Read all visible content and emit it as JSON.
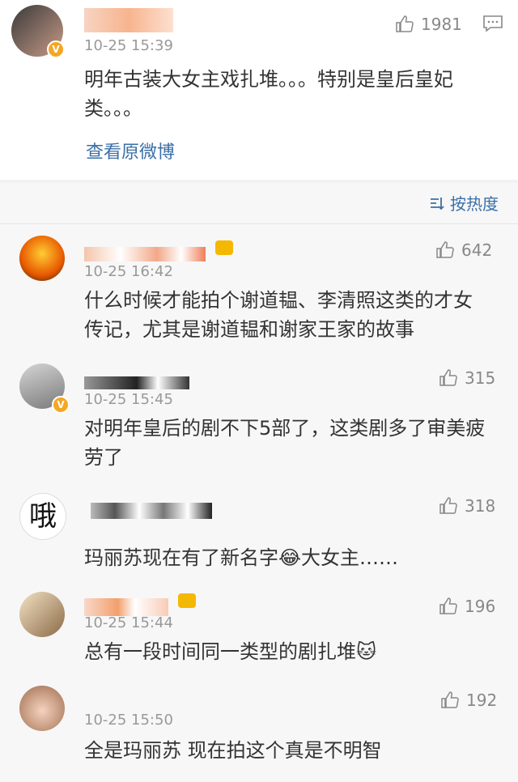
{
  "post": {
    "time": "10-25 15:39",
    "text": "明年古装大女主戏扎堆。。。特别是皇后皇妃类。。。",
    "likes": "1981",
    "view_original": "查看原微博"
  },
  "sort_label": "按热度",
  "comments": [
    {
      "time": "10-25 16:42",
      "text": "什么时候才能拍个谢道韫、李清照这类的才女传记，尤其是谢道韫和谢家王家的故事",
      "likes": "642"
    },
    {
      "time": "10-25 15:45",
      "text": "对明年皇后的剧不下5部了，这类剧多了审美疲劳了",
      "likes": "315"
    },
    {
      "time": "",
      "text": "玛丽苏现在有了新名字😂大女主……",
      "likes": "318"
    },
    {
      "time": "10-25 15:44",
      "text": "总有一段时间同一类型的剧扎堆🐱",
      "likes": "196"
    },
    {
      "time": "10-25 15:50",
      "text": "全是玛丽苏 现在拍这个真是不明智",
      "likes": "192"
    }
  ],
  "avatar4_text": "哦",
  "colors": {
    "link": "#3b6fa6",
    "badge": "#f5a623",
    "bg": "#f2f2f2"
  }
}
